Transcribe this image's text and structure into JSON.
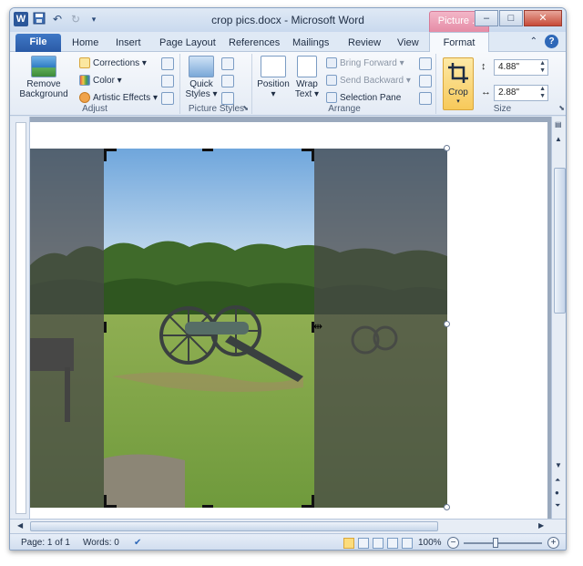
{
  "title_bar": {
    "window_title": "crop pics.docx - Microsoft Word",
    "contextual_tab_header": "Picture ...",
    "word_logo": "W",
    "qat_icons": [
      "save-icon",
      "undo-icon",
      "redo-icon",
      "customize-icon"
    ],
    "controls": {
      "minimize": "–",
      "maximize": "□",
      "close": "✕"
    }
  },
  "tabs": {
    "file": "File",
    "home": "Home",
    "insert": "Insert",
    "page_layout": "Page Layout",
    "references": "References",
    "mailings": "Mailings",
    "review": "Review",
    "view": "View",
    "format": "Format"
  },
  "ribbon": {
    "adjust": {
      "label": "Adjust",
      "remove_background": "Remove Background",
      "corrections": "Corrections",
      "color": "Color",
      "artistic_effects": "Artistic Effects"
    },
    "picture_styles": {
      "label": "Picture Styles",
      "quick_styles": "Quick Styles"
    },
    "arrange": {
      "label": "Arrange",
      "position": "Position",
      "wrap_text": "Wrap Text",
      "bring_forward": "Bring Forward",
      "send_backward": "Send Backward",
      "selection_pane": "Selection Pane"
    },
    "size": {
      "label": "Size",
      "crop": "Crop",
      "height_value": "4.88\"",
      "width_value": "2.88\""
    }
  },
  "status_bar": {
    "page": "Page: 1 of 1",
    "words": "Words: 0",
    "zoom": "100%",
    "zoom_level_percent": 100,
    "zoom_minus": "−",
    "zoom_plus": "+"
  },
  "colors": {
    "file_tab": "#2a5aa6",
    "contextual_tab": "#e58ca6",
    "crop_highlight": "#f7c95a",
    "window_frame": "#dbe5f1"
  }
}
